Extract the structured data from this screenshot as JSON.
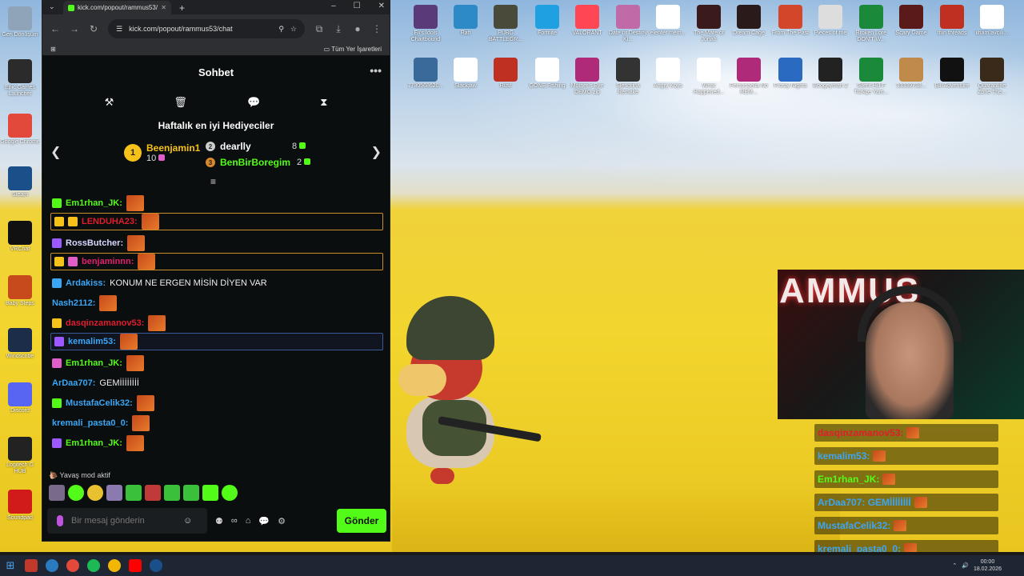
{
  "browser": {
    "tab_title": "kick.com/popout/rammus53/ch",
    "url": "kick.com/popout/rammus53/chat",
    "bookmarks_label": "Tüm Yer İşaretleri"
  },
  "kick": {
    "header_title": "Sohbet",
    "gifters_title": "Haftalık en iyi Hediyeciler",
    "gifters": [
      {
        "rank": "1",
        "name": "Beenjamin1",
        "count": "10",
        "color": "#f6c21a"
      },
      {
        "rank": "2",
        "name": "dearlly",
        "count": "8",
        "color": "#ffffff"
      },
      {
        "rank": "3",
        "name": "BenBirBoregim",
        "count": "2",
        "color": "#53fc18"
      }
    ],
    "messages": [
      {
        "user": "Em1rhan_JK:",
        "color": "#53fc18",
        "text": "",
        "style": ""
      },
      {
        "user": "LENDUHA23:",
        "color": "#e01c2d",
        "text": "",
        "style": "hl"
      },
      {
        "user": "RossButcher:",
        "color": "#d8d8ff",
        "text": "",
        "style": ""
      },
      {
        "user": "benjaminnn:",
        "color": "#e0206e",
        "text": "",
        "style": "hl"
      },
      {
        "user": "Ardakiss:",
        "color": "#3aa6f5",
        "text": "KONUM NE ERGEN MİSİN DİYEN VAR",
        "style": ""
      },
      {
        "user": "Nash2112:",
        "color": "#3aa6f5",
        "text": "",
        "style": ""
      },
      {
        "user": "dasqinzamanov53:",
        "color": "#e01c2d",
        "text": "",
        "style": ""
      },
      {
        "user": "kemalim53:",
        "color": "#3aa6f5",
        "text": "",
        "style": "hl2"
      },
      {
        "user": "Em1rhan_JK:",
        "color": "#53fc18",
        "text": "",
        "style": ""
      },
      {
        "user": "ArDaa707:",
        "color": "#3aa6f5",
        "text": "GEMİİİİİİİİ",
        "style": ""
      },
      {
        "user": "MustafaCelik32:",
        "color": "#3aa6f5",
        "text": "",
        "style": ""
      },
      {
        "user": "kremali_pasta0_0:",
        "color": "#3aa6f5",
        "text": "",
        "style": ""
      },
      {
        "user": "Em1rhan_JK:",
        "color": "#53fc18",
        "text": "",
        "style": ""
      }
    ],
    "slow_mode": "Yavaş mod aktif",
    "input_placeholder": "Bir mesaj gönderin",
    "send_label": "Gönder"
  },
  "overlay_chat": [
    {
      "user": "dasqinzamanov53:",
      "color": "#e01c2d"
    },
    {
      "user": "kemalim53:",
      "color": "#3aa6f5"
    },
    {
      "user": "Em1rhan_JK:",
      "color": "#53fc18"
    },
    {
      "user": "ArDaa707: GEMİİİİİİİİ",
      "color": "#3aa6f5"
    },
    {
      "user": "MustafaCelik32:",
      "color": "#3aa6f5"
    },
    {
      "user": "kremali_pasta0_0:",
      "color": "#3aa6f5"
    }
  ],
  "webcam": {
    "banner": "AMMUS"
  },
  "left_icons": [
    {
      "label": "Geri Dönüşüm",
      "color": "#8fa4b8"
    },
    {
      "label": "Epic Games Launcher",
      "color": "#2b2b2b"
    },
    {
      "label": "Google Chrome",
      "color": "#e2493a"
    },
    {
      "label": "Steam",
      "color": "#1b4f8a"
    },
    {
      "label": "VRChat",
      "color": "#111111"
    },
    {
      "label": "Baby Steps",
      "color": "#c64a1c"
    },
    {
      "label": "Windscribe",
      "color": "#1c2d4a"
    },
    {
      "label": "Discord",
      "color": "#5865f2"
    },
    {
      "label": "Logitech G HUB",
      "color": "#222222"
    },
    {
      "label": "Soundpad",
      "color": "#d11a1a"
    }
  ],
  "desktop_icons": [
    {
      "label": "Eli's Idols Chartbound",
      "color": "#5a3a78"
    },
    {
      "label": "Raft",
      "color": "#2d8ac7"
    },
    {
      "label": "PUBG BATTLEGR...",
      "color": "#4a4a3a"
    },
    {
      "label": "Fortnite",
      "color": "#1fa0e0"
    },
    {
      "label": "VALORANT",
      "color": "#ff4655"
    },
    {
      "label": "Date or Destiny Ki...",
      "color": "#c06ba8"
    },
    {
      "label": "elenter mem...",
      "color": "#ffffff"
    },
    {
      "label": "The Mare of Jonah",
      "color": "#3a1a1a"
    },
    {
      "label": "Dream Cage",
      "color": "#2a1a1a"
    },
    {
      "label": "From The Past",
      "color": "#d4462a"
    },
    {
      "label": "Pieces of me",
      "color": "#dddddd"
    },
    {
      "label": "Broken Lore DON'T W...",
      "color": "#1a8a3a"
    },
    {
      "label": "Scary Game",
      "color": "#5a1a1a"
    },
    {
      "label": "thin threads",
      "color": "#c03020"
    },
    {
      "label": "ilham avcılı...",
      "color": "#ffffff"
    }
  ],
  "desktop_icons_row2": [
    {
      "label": "7780568620...",
      "color": "#3a6a9a"
    },
    {
      "label": "Slackjaw",
      "color": "#ffffff"
    },
    {
      "label": "Rust",
      "color": "#c03020"
    },
    {
      "label": "GONE Fishing",
      "color": "#ffffff"
    },
    {
      "label": "Mother's Eye DEMO zip",
      "color": "#b02a7a"
    },
    {
      "label": "Slendrina Remake",
      "color": "#333333"
    },
    {
      "label": "Angry Koys",
      "color": "#ffffff"
    },
    {
      "label": "What Happened...",
      "color": "#ffffff"
    },
    {
      "label": "Personaelia No REM...",
      "color": "#b02a7a"
    },
    {
      "label": "Frosty Nights",
      "color": "#2a6ac0"
    },
    {
      "label": "Boogeyman 2",
      "color": "#222222"
    },
    {
      "label": "Silent Hill F Türkçe Yam...",
      "color": "#1a8a3a"
    },
    {
      "label": "33339738...",
      "color": "#c08a4a"
    },
    {
      "label": "Bill Adventure",
      "color": "#111111"
    },
    {
      "label": "Quarantine Zone The...",
      "color": "#3a2a1a"
    }
  ],
  "taskbar": {
    "time": "00:00",
    "date": "18.02.2026"
  }
}
